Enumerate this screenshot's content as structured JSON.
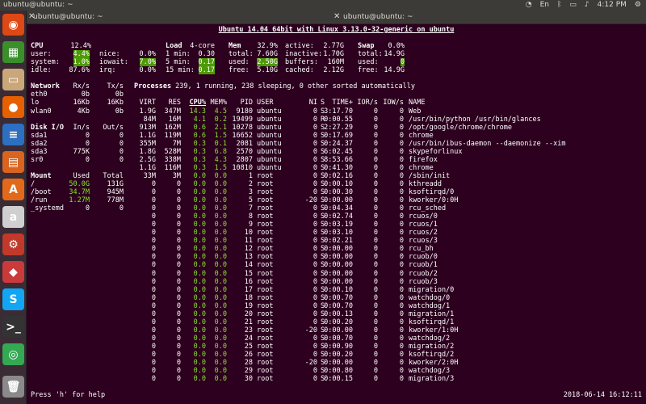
{
  "topbar": {
    "title": "ubuntu@ubuntu: ~",
    "lang": "En",
    "time": "4:12 PM"
  },
  "launcher": [
    {
      "name": "ubuntu-dash",
      "glyph": "◉",
      "color": "#dd4814"
    },
    {
      "name": "libreoffice-calc",
      "glyph": "▦",
      "color": "#3a8f2a"
    },
    {
      "name": "files",
      "glyph": "▭",
      "color": "#c9a77a"
    },
    {
      "name": "firefox",
      "glyph": "●",
      "color": "#e66000"
    },
    {
      "name": "libreoffice-writer",
      "glyph": "≡",
      "color": "#2d6fc1"
    },
    {
      "name": "libreoffice-impress",
      "glyph": "▤",
      "color": "#d8641f"
    },
    {
      "name": "software-center",
      "glyph": "A",
      "color": "#e2691a"
    },
    {
      "name": "amazon",
      "glyph": "a",
      "color": "#cfcfcf"
    },
    {
      "name": "system-settings",
      "glyph": "⚙",
      "color": "#c0392b"
    },
    {
      "name": "remmina",
      "glyph": "◆",
      "color": "#c93a3a"
    },
    {
      "name": "skype",
      "glyph": "S",
      "color": "#12a5f4"
    },
    {
      "name": "terminal",
      "glyph": ">_",
      "color": "#333333"
    },
    {
      "name": "chrome",
      "glyph": "◎",
      "color": "#34a853"
    },
    {
      "name": "trash",
      "glyph": "🗑",
      "color": "#8a8a8a"
    }
  ],
  "tabs": [
    "ubuntu@ubuntu: ~",
    "ubuntu@ubuntu: ~"
  ],
  "header": "Ubuntu 14.04 64bit with Linux 3.13.0-32-generic on ubuntu",
  "cpu": {
    "title": "CPU",
    "total": "12.4%",
    "rows": [
      [
        "user:",
        "4.4%",
        "nice:",
        "0.0%"
      ],
      [
        "system:",
        "1.0%",
        "iowait:",
        "7.0%"
      ],
      [
        "idle:",
        "87.6%",
        "irq:",
        "0.0%"
      ]
    ]
  },
  "load": {
    "title": "Load",
    "cores": "4-core",
    "rows": [
      [
        "1 min:",
        "0.30"
      ],
      [
        "5 min:",
        "0.17"
      ],
      [
        "15 min:",
        "0.17"
      ]
    ]
  },
  "mem": {
    "title": "Mem",
    "total": "32.9%",
    "rows": [
      [
        "total:",
        "7.60G"
      ],
      [
        "used:",
        "2.50G"
      ],
      [
        "free:",
        "5.10G"
      ]
    ],
    "extra_left": [
      "active:",
      "inactive:",
      "buffers:",
      "cached:"
    ],
    "extra_right": [
      "2.77G",
      "1.70G",
      "160M",
      "2.12G"
    ]
  },
  "swap": {
    "title": "Swap",
    "total": "0.0%",
    "rows": [
      [
        "total:",
        "14.9G"
      ],
      [
        "used:",
        "0"
      ],
      [
        "free:",
        "14.9G"
      ]
    ]
  },
  "network": {
    "headers": [
      "Network",
      "Rx/s",
      "Tx/s"
    ],
    "rows": [
      [
        "eth0",
        "0b",
        "0b"
      ],
      [
        "lo",
        "16Kb",
        "16Kb"
      ],
      [
        "wlan0",
        "4Kb",
        "0b"
      ]
    ]
  },
  "diskio": {
    "headers": [
      "Disk I/O",
      "In/s",
      "Out/s"
    ],
    "rows": [
      [
        "sda1",
        "0",
        "0"
      ],
      [
        "sda2",
        "0",
        "0"
      ],
      [
        "sda3",
        "775K",
        "0"
      ],
      [
        "sr0",
        "0",
        "0"
      ]
    ]
  },
  "mount": {
    "headers": [
      "Mount",
      "Used",
      "Total"
    ],
    "rows": [
      [
        "/",
        "50.0G",
        "131G"
      ],
      [
        "/boot",
        "34.7M",
        "945M"
      ],
      [
        "/run",
        "1.27M",
        "778M"
      ],
      [
        "_systemd",
        "0",
        "0"
      ]
    ]
  },
  "processes_summary": "Processes 239, 1 running, 238 sleeping, 0 other sorted automatically",
  "proc_headers": [
    "VIRT",
    "RES",
    "CPU%",
    "MEM%",
    "PID",
    "USER",
    "NI",
    "S",
    "TIME+",
    "IOR/s",
    "IOW/s",
    "NAME"
  ],
  "processes": [
    [
      "1.9G",
      "347M",
      "14.3",
      "4.5",
      "9180",
      "ubuntu",
      "0",
      "S",
      "3:17.70",
      "0",
      "0",
      "Web"
    ],
    [
      "84M",
      "16M",
      "4.1",
      "0.2",
      "19499",
      "ubuntu",
      "0",
      "R",
      "0:00.55",
      "0",
      "0",
      "/usr/bin/python /usr/bin/glances"
    ],
    [
      "913M",
      "162M",
      "0.6",
      "2.1",
      "10278",
      "ubuntu",
      "0",
      "S",
      "2:27.29",
      "0",
      "0",
      "/opt/google/chrome/chrome"
    ],
    [
      "1.1G",
      "119M",
      "0.6",
      "1.5",
      "16652",
      "ubuntu",
      "0",
      "S",
      "0:17.69",
      "0",
      "0",
      "chrome"
    ],
    [
      "355M",
      "7M",
      "0.3",
      "0.1",
      "2081",
      "ubuntu",
      "0",
      "S",
      "0:24.37",
      "0",
      "0",
      "/usr/bin/ibus-daemon --daemonize --xim"
    ],
    [
      "1.8G",
      "528M",
      "0.3",
      "6.8",
      "2570",
      "ubuntu",
      "0",
      "S",
      "6:02.45",
      "0",
      "0",
      "skypeforlinux"
    ],
    [
      "2.5G",
      "338M",
      "0.3",
      "4.3",
      "2807",
      "ubuntu",
      "0",
      "S",
      "8:53.66",
      "0",
      "0",
      "firefox"
    ],
    [
      "1.1G",
      "116M",
      "0.3",
      "1.5",
      "10810",
      "ubuntu",
      "0",
      "S",
      "0:41.30",
      "0",
      "0",
      "chrome"
    ],
    [
      "33M",
      "3M",
      "0.0",
      "0.0",
      "1",
      "root",
      "0",
      "S",
      "0:02.16",
      "0",
      "0",
      "/sbin/init"
    ],
    [
      "0",
      "0",
      "0.0",
      "0.0",
      "2",
      "root",
      "0",
      "S",
      "0:00.10",
      "0",
      "0",
      "kthreadd"
    ],
    [
      "0",
      "0",
      "0.0",
      "0.0",
      "3",
      "root",
      "0",
      "S",
      "0:00.30",
      "0",
      "0",
      "ksoftirqd/0"
    ],
    [
      "0",
      "0",
      "0.0",
      "0.0",
      "5",
      "root",
      "-20",
      "S",
      "0:00.00",
      "0",
      "0",
      "kworker/0:0H"
    ],
    [
      "0",
      "0",
      "0.0",
      "0.0",
      "7",
      "root",
      "0",
      "S",
      "0:04.34",
      "0",
      "0",
      "rcu_sched"
    ],
    [
      "0",
      "0",
      "0.0",
      "0.0",
      "8",
      "root",
      "0",
      "S",
      "0:02.74",
      "0",
      "0",
      "rcuos/0"
    ],
    [
      "0",
      "0",
      "0.0",
      "0.0",
      "9",
      "root",
      "0",
      "S",
      "0:03.19",
      "0",
      "0",
      "rcuos/1"
    ],
    [
      "0",
      "0",
      "0.0",
      "0.0",
      "10",
      "root",
      "0",
      "S",
      "0:03.10",
      "0",
      "0",
      "rcuos/2"
    ],
    [
      "0",
      "0",
      "0.0",
      "0.0",
      "11",
      "root",
      "0",
      "S",
      "0:02.21",
      "0",
      "0",
      "rcuos/3"
    ],
    [
      "0",
      "0",
      "0.0",
      "0.0",
      "12",
      "root",
      "0",
      "S",
      "0:00.00",
      "0",
      "0",
      "rcu_bh"
    ],
    [
      "0",
      "0",
      "0.0",
      "0.0",
      "13",
      "root",
      "0",
      "S",
      "0:00.00",
      "0",
      "0",
      "rcuob/0"
    ],
    [
      "0",
      "0",
      "0.0",
      "0.0",
      "14",
      "root",
      "0",
      "S",
      "0:00.00",
      "0",
      "0",
      "rcuob/1"
    ],
    [
      "0",
      "0",
      "0.0",
      "0.0",
      "15",
      "root",
      "0",
      "S",
      "0:00.00",
      "0",
      "0",
      "rcuob/2"
    ],
    [
      "0",
      "0",
      "0.0",
      "0.0",
      "16",
      "root",
      "0",
      "S",
      "0:00.00",
      "0",
      "0",
      "rcuob/3"
    ],
    [
      "0",
      "0",
      "0.0",
      "0.0",
      "17",
      "root",
      "0",
      "S",
      "0:00.10",
      "0",
      "0",
      "migration/0"
    ],
    [
      "0",
      "0",
      "0.0",
      "0.0",
      "18",
      "root",
      "0",
      "S",
      "0:00.70",
      "0",
      "0",
      "watchdog/0"
    ],
    [
      "0",
      "0",
      "0.0",
      "0.0",
      "19",
      "root",
      "0",
      "S",
      "0:00.70",
      "0",
      "0",
      "watchdog/1"
    ],
    [
      "0",
      "0",
      "0.0",
      "0.0",
      "20",
      "root",
      "0",
      "S",
      "0:00.13",
      "0",
      "0",
      "migration/1"
    ],
    [
      "0",
      "0",
      "0.0",
      "0.0",
      "21",
      "root",
      "0",
      "S",
      "0:00.20",
      "0",
      "0",
      "ksoftirqd/1"
    ],
    [
      "0",
      "0",
      "0.0",
      "0.0",
      "23",
      "root",
      "-20",
      "S",
      "0:00.00",
      "0",
      "0",
      "kworker/1:0H"
    ],
    [
      "0",
      "0",
      "0.0",
      "0.0",
      "24",
      "root",
      "0",
      "S",
      "0:00.70",
      "0",
      "0",
      "watchdog/2"
    ],
    [
      "0",
      "0",
      "0.0",
      "0.0",
      "25",
      "root",
      "0",
      "S",
      "0:00.90",
      "0",
      "0",
      "migration/2"
    ],
    [
      "0",
      "0",
      "0.0",
      "0.0",
      "26",
      "root",
      "0",
      "S",
      "0:00.20",
      "0",
      "0",
      "ksoftirqd/2"
    ],
    [
      "0",
      "0",
      "0.0",
      "0.0",
      "28",
      "root",
      "-20",
      "S",
      "0:00.00",
      "0",
      "0",
      "kworker/2:0H"
    ],
    [
      "0",
      "0",
      "0.0",
      "0.0",
      "29",
      "root",
      "0",
      "S",
      "0:00.80",
      "0",
      "0",
      "watchdog/3"
    ],
    [
      "0",
      "0",
      "0.0",
      "0.0",
      "30",
      "root",
      "0",
      "S",
      "0:00.15",
      "0",
      "0",
      "migration/3"
    ]
  ],
  "footer": {
    "help": "Press 'h' for help",
    "datetime": "2018-06-14 16:12:11"
  }
}
